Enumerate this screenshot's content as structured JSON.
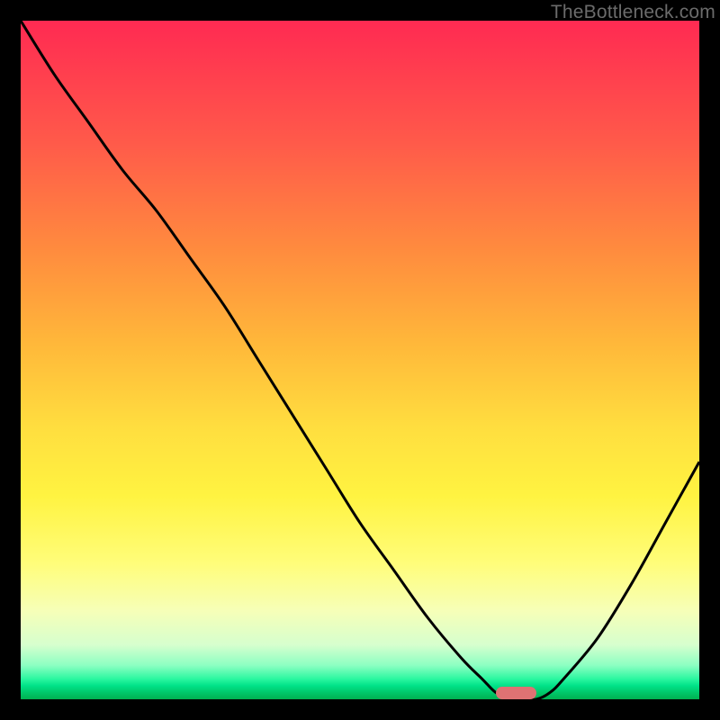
{
  "watermark": "TheBottleneck.com",
  "colors": {
    "marker": "#de7273",
    "curve": "#000000"
  },
  "chart_data": {
    "type": "line",
    "title": "",
    "xlabel": "",
    "ylabel": "",
    "xlim": [
      0,
      100
    ],
    "ylim": [
      0,
      100
    ],
    "grid": false,
    "legend": false,
    "annotations": [
      {
        "text": "TheBottleneck.com",
        "pos": "top-right"
      }
    ],
    "series": [
      {
        "name": "bottleneck-curve",
        "x": [
          0,
          5,
          10,
          15,
          20,
          25,
          30,
          35,
          40,
          45,
          50,
          55,
          60,
          65,
          68,
          70,
          72,
          74,
          76,
          78,
          80,
          85,
          90,
          95,
          100
        ],
        "values": [
          100,
          92,
          85,
          78,
          72,
          65,
          58,
          50,
          42,
          34,
          26,
          19,
          12,
          6,
          3,
          1,
          0,
          0,
          0,
          1,
          3,
          9,
          17,
          26,
          35
        ]
      }
    ],
    "optimum_marker": {
      "x": 73,
      "y": 0,
      "width": 6
    }
  }
}
